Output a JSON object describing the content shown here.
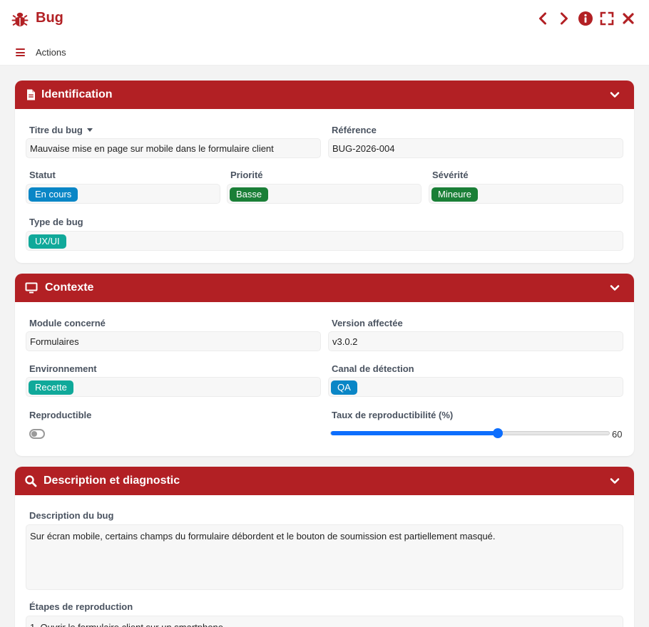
{
  "window": {
    "title": "Bug",
    "actions_label": "Actions",
    "buttons": [
      "chevron-left-icon",
      "chevron-right-icon",
      "info-icon",
      "fullscreen-icon",
      "close-icon"
    ]
  },
  "colors": {
    "brand": "#b22024",
    "tag_blue": "#0a86c6",
    "tag_green": "#1a7f37",
    "tag_teal": "#10a99a",
    "slider": "#0d6efd"
  },
  "sections": {
    "identification": {
      "title": "Identification",
      "titre_label": "Titre du bug",
      "titre_value": "Mauvaise mise en page sur mobile dans le formulaire client",
      "reference_label": "Référence",
      "reference_value": "BUG-2026-004",
      "statut_label": "Statut",
      "statut_value": "En cours",
      "priorite_label": "Priorité",
      "priorite_value": "Basse",
      "severite_label": "Sévérité",
      "severite_value": "Mineure",
      "type_label": "Type de bug",
      "type_value": "UX/UI"
    },
    "contexte": {
      "title": "Contexte",
      "module_label": "Module concerné",
      "module_value": "Formulaires",
      "version_label": "Version affectée",
      "version_value": "v3.0.2",
      "env_label": "Environnement",
      "env_value": "Recette",
      "canal_label": "Canal de détection",
      "canal_value": "QA",
      "repro_label": "Reproductible",
      "repro_value": false,
      "taux_label": "Taux de reproductibilité (%)",
      "taux_value": "60",
      "taux_max": 100
    },
    "description": {
      "title": "Description et diagnostic",
      "desc_label": "Description du bug",
      "desc_value": "Sur écran mobile, certains champs du formulaire débordent et le bouton de soumission est partiellement masqué.",
      "etapes_label": "Étapes de reproduction",
      "etapes_value": "1. Ouvrir le formulaire client sur un smartphone"
    }
  }
}
